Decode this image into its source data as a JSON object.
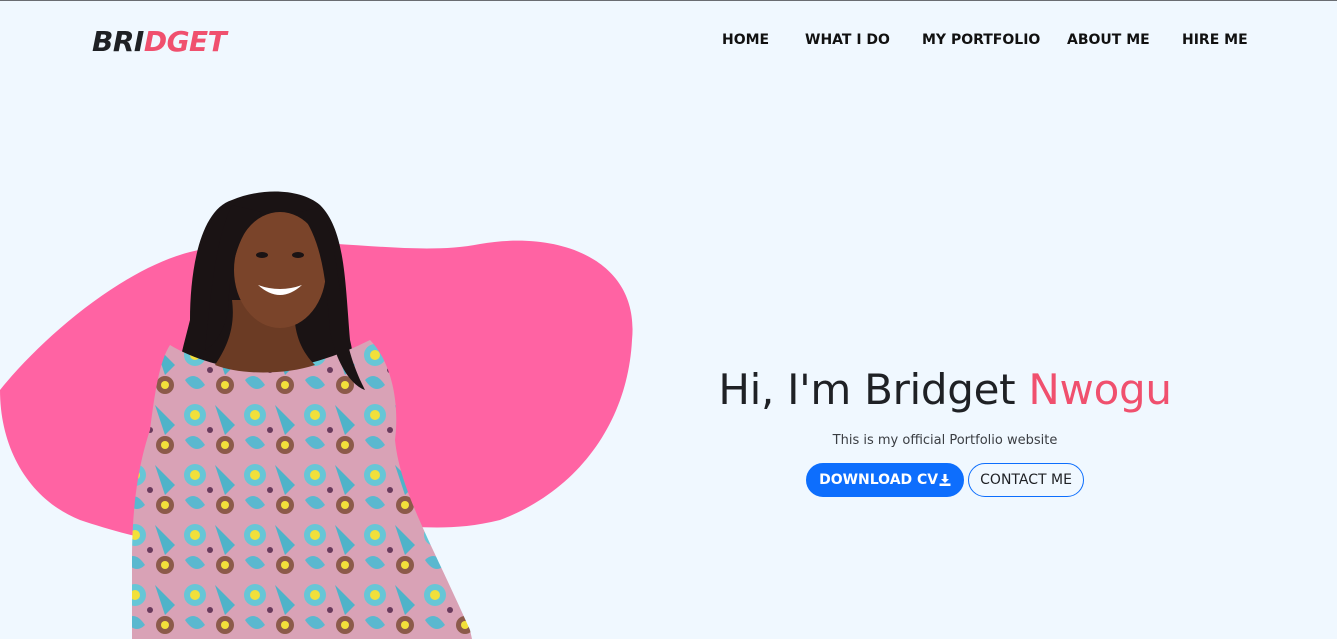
{
  "brand": {
    "part1": "BRI",
    "part2": "DGET"
  },
  "nav": {
    "items": [
      {
        "label": "HOME"
      },
      {
        "label": "WHAT I DO"
      },
      {
        "label": "MY PORTFOLIO"
      },
      {
        "label": "ABOUT ME"
      },
      {
        "label": "HIRE ME"
      }
    ]
  },
  "hero": {
    "greeting": "Hi, I'm Bridget ",
    "surname": "Nwogu",
    "subtitle": "This is my official Portfolio website",
    "download_label": "DOWNLOAD CV",
    "download_icon": "download-icon",
    "contact_label": "CONTACT ME"
  },
  "colors": {
    "accent": "#f0506e",
    "blob": "#ff63a3",
    "primary": "#0d6efd",
    "background": "#f0f8ff"
  }
}
